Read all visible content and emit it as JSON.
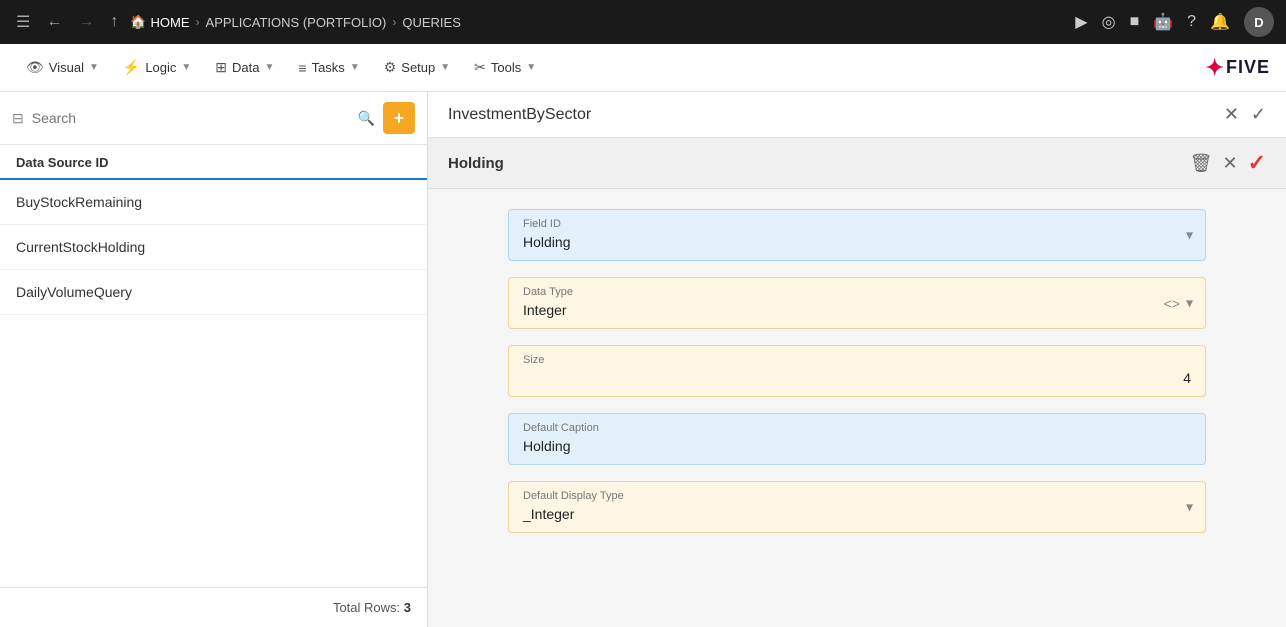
{
  "topNav": {
    "breadcrumbs": [
      "HOME",
      "APPLICATIONS (PORTFOLIO)",
      "QUERIES"
    ],
    "avatarLabel": "D"
  },
  "menuBar": {
    "items": [
      {
        "id": "visual",
        "label": "Visual",
        "icon": "👁"
      },
      {
        "id": "logic",
        "label": "Logic",
        "icon": "⚡"
      },
      {
        "id": "data",
        "label": "Data",
        "icon": "⊞"
      },
      {
        "id": "tasks",
        "label": "Tasks",
        "icon": "≡"
      },
      {
        "id": "setup",
        "label": "Setup",
        "icon": "⚙"
      },
      {
        "id": "tools",
        "label": "Tools",
        "icon": "✂"
      }
    ]
  },
  "sidebar": {
    "searchPlaceholder": "Search",
    "headerLabel": "Data Source ID",
    "items": [
      {
        "id": "buy-stock",
        "label": "BuyStockRemaining"
      },
      {
        "id": "current-stock",
        "label": "CurrentStockHolding"
      },
      {
        "id": "daily-volume",
        "label": "DailyVolumeQuery"
      }
    ],
    "footer": "Total Rows: ",
    "totalRows": "3"
  },
  "panel": {
    "title": "InvestmentBySector",
    "sectionTitle": "Holding",
    "fields": [
      {
        "id": "field-id",
        "label": "Field ID",
        "value": "Holding",
        "type": "blue",
        "hasDropdown": true
      },
      {
        "id": "data-type",
        "label": "Data Type",
        "value": "Integer",
        "type": "yellow",
        "hasCodeIcon": true,
        "hasDropdown": true
      },
      {
        "id": "size",
        "label": "Size",
        "value": "4",
        "type": "yellow",
        "valueAlign": "right"
      },
      {
        "id": "default-caption",
        "label": "Default Caption",
        "value": "Holding",
        "type": "blue"
      },
      {
        "id": "default-display-type",
        "label": "Default Display Type",
        "value": "_Integer",
        "type": "yellow",
        "hasDropdown": true
      }
    ],
    "actions": {
      "delete": "🗑",
      "close": "✕",
      "confirm": "✓"
    }
  }
}
